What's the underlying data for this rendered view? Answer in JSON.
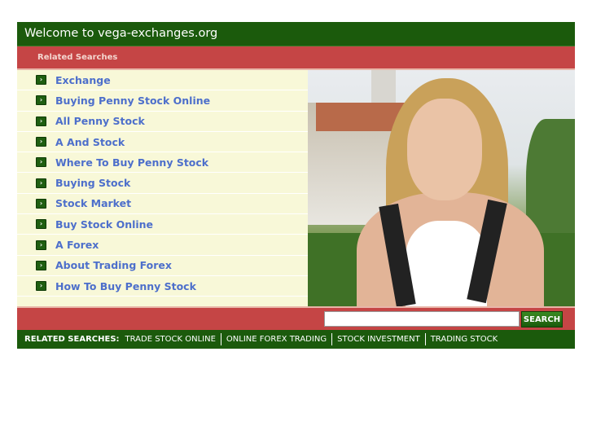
{
  "header": {
    "title": "Welcome to vega-exchanges.org"
  },
  "related_bar": {
    "label": "Related Searches"
  },
  "list": {
    "items": [
      {
        "label": "Exchange"
      },
      {
        "label": "Buying Penny Stock Online"
      },
      {
        "label": "All Penny Stock"
      },
      {
        "label": "A And Stock"
      },
      {
        "label": "Where To Buy Penny Stock"
      },
      {
        "label": "Buying Stock"
      },
      {
        "label": "Stock Market"
      },
      {
        "label": "Buy Stock Online"
      },
      {
        "label": "A Forex"
      },
      {
        "label": "About Trading Forex"
      },
      {
        "label": "How To Buy Penny Stock"
      }
    ]
  },
  "search": {
    "value": "",
    "placeholder": "",
    "button_label": "SEARCH"
  },
  "bottom": {
    "label": "RELATED SEARCHES:",
    "links": [
      {
        "label": "TRADE STOCK ONLINE"
      },
      {
        "label": "ONLINE FOREX TRADING"
      },
      {
        "label": "STOCK INVESTMENT"
      },
      {
        "label": "TRADING STOCK"
      }
    ]
  },
  "colors": {
    "green": "#1b5a0c",
    "red": "#c54545",
    "list_bg": "#f8f8d8",
    "link": "#4d6fcb"
  }
}
